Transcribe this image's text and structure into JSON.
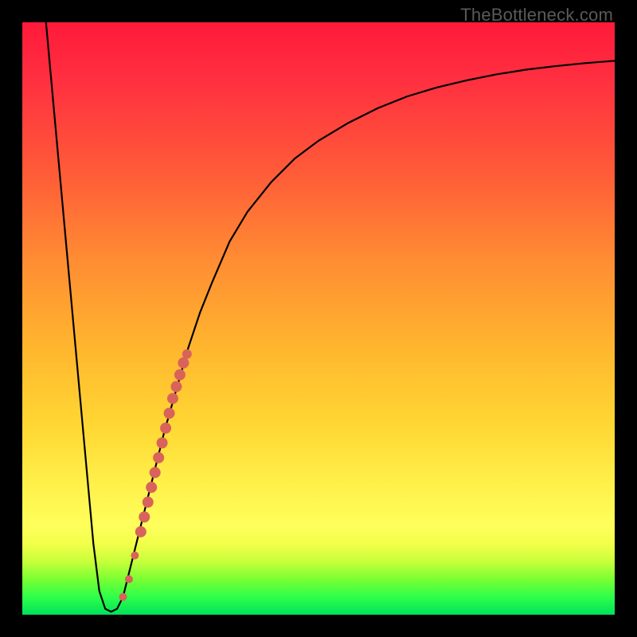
{
  "watermark": "TheBottleneck.com",
  "colors": {
    "frame": "#000000",
    "curve_stroke": "#000000",
    "marker_fill": "#d9635a",
    "marker_stroke": "#a84b45"
  },
  "chart_data": {
    "type": "line",
    "title": "",
    "xlabel": "",
    "ylabel": "",
    "xlim": [
      0,
      100
    ],
    "ylim": [
      0,
      100
    ],
    "series": [
      {
        "name": "bottleneck-curve",
        "x": [
          4,
          6,
          8,
          10,
          12,
          13,
          14,
          15,
          16,
          17,
          18,
          20,
          22,
          24,
          26,
          28,
          30,
          32,
          35,
          38,
          42,
          46,
          50,
          55,
          60,
          65,
          70,
          75,
          80,
          85,
          90,
          95,
          100
        ],
        "y": [
          100,
          78,
          56,
          34,
          12,
          4,
          1,
          0.5,
          1,
          3,
          7,
          15,
          23,
          31,
          38,
          45,
          51,
          56,
          63,
          68,
          73,
          77,
          80,
          83,
          85.5,
          87.5,
          89,
          90.2,
          91.2,
          92,
          92.6,
          93.1,
          93.5
        ]
      }
    ],
    "markers": {
      "name": "highlight-segment",
      "points": [
        {
          "x": 17.0,
          "y": 3.0,
          "r": 5
        },
        {
          "x": 18.0,
          "y": 6.0,
          "r": 5
        },
        {
          "x": 19.0,
          "y": 10.0,
          "r": 5
        },
        {
          "x": 20.0,
          "y": 14.0,
          "r": 7
        },
        {
          "x": 20.6,
          "y": 16.5,
          "r": 7
        },
        {
          "x": 21.2,
          "y": 19.0,
          "r": 7
        },
        {
          "x": 21.8,
          "y": 21.5,
          "r": 7
        },
        {
          "x": 22.4,
          "y": 24.0,
          "r": 7
        },
        {
          "x": 23.0,
          "y": 26.5,
          "r": 7
        },
        {
          "x": 23.6,
          "y": 29.0,
          "r": 7
        },
        {
          "x": 24.2,
          "y": 31.5,
          "r": 7
        },
        {
          "x": 24.8,
          "y": 34.0,
          "r": 7
        },
        {
          "x": 25.4,
          "y": 36.5,
          "r": 7
        },
        {
          "x": 26.0,
          "y": 38.5,
          "r": 7
        },
        {
          "x": 26.6,
          "y": 40.5,
          "r": 7
        },
        {
          "x": 27.2,
          "y": 42.5,
          "r": 7
        },
        {
          "x": 27.8,
          "y": 44.0,
          "r": 6
        }
      ]
    }
  }
}
